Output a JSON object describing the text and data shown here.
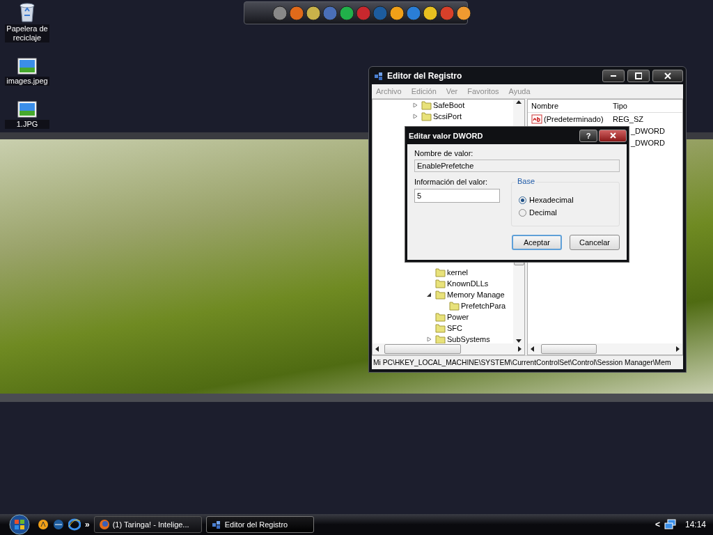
{
  "desktop_icons": [
    {
      "label": "Papelera de reciclaje",
      "kind": "bin"
    },
    {
      "label": "images.jpeg",
      "kind": "image"
    },
    {
      "label": "1.JPG",
      "kind": "image"
    }
  ],
  "registry_window": {
    "title": "Editor del Registro",
    "menu": [
      "Archivo",
      "Edición",
      "Ver",
      "Favoritos",
      "Ayuda"
    ],
    "tree_upper": [
      {
        "label": "SafeBoot",
        "expanded": false
      },
      {
        "label": "ScsiPort",
        "expanded": false
      }
    ],
    "tree_lower": [
      {
        "label": "kernel"
      },
      {
        "label": "KnownDLLs"
      },
      {
        "label": "Memory Manage",
        "expanded": true,
        "children": [
          {
            "label": "PrefetchPara"
          }
        ]
      },
      {
        "label": "Power"
      },
      {
        "label": "SFC"
      },
      {
        "label": "SubSystems",
        "expanded": false
      }
    ],
    "columns": [
      "Nombre",
      "Tipo"
    ],
    "rows": [
      {
        "name": "(Predeterminado)",
        "type": "REG_SZ",
        "kind": "string"
      },
      {
        "type": "_DWORD"
      },
      {
        "type": "_DWORD"
      }
    ],
    "status_bar": "Mi PC\\HKEY_LOCAL_MACHINE\\SYSTEM\\CurrentControlSet\\Control\\Session Manager\\Mem"
  },
  "dialog": {
    "title": "Editar valor DWORD",
    "help_button": "?",
    "name_label": "Nombre de valor:",
    "name_value": "EnablePrefetche",
    "data_label": "Información del valor:",
    "data_value": "5",
    "base_label": "Base",
    "radios": [
      {
        "label": "Hexadecimal",
        "selected": true
      },
      {
        "label": "Decimal",
        "selected": false
      }
    ],
    "buttons": [
      {
        "label": "Aceptar",
        "default": true
      },
      {
        "label": "Cancelar",
        "default": false
      }
    ]
  },
  "taskbar": {
    "chevron": "»",
    "tasks": [
      {
        "label": "(1) Taringa! - Intelige...",
        "selected": false,
        "kind": "browser"
      },
      {
        "label": "Editor del Registro",
        "selected": true,
        "kind": "regedit"
      }
    ],
    "tray_chevron": "<",
    "clock": "14:14"
  }
}
